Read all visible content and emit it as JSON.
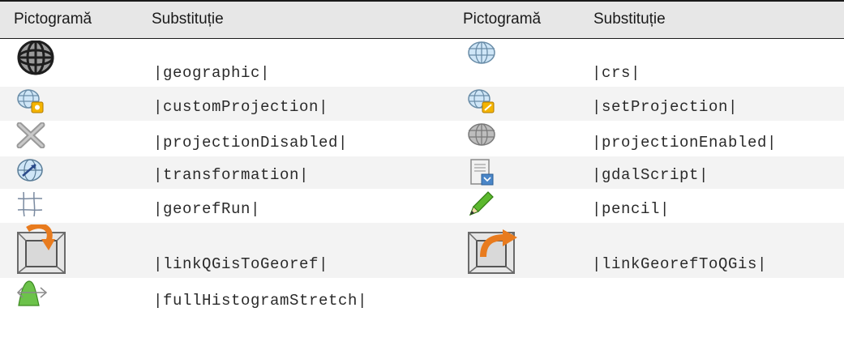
{
  "header": {
    "pictogram_label_1": "Pictogramă",
    "substitution_label_1": "Substituție",
    "pictogram_label_2": "Pictogramă",
    "substitution_label_2": "Substituție"
  },
  "rows": [
    {
      "left": {
        "icon": "geographic-globe-icon",
        "code": "|geographic|"
      },
      "right": {
        "icon": "crs-globe-icon",
        "code": "|crs|"
      }
    },
    {
      "left": {
        "icon": "custom-projection-icon",
        "code": "|customProjection|"
      },
      "right": {
        "icon": "set-projection-icon",
        "code": "|setProjection|"
      }
    },
    {
      "left": {
        "icon": "projection-disabled-icon",
        "code": "|projectionDisabled|"
      },
      "right": {
        "icon": "projection-enabled-icon",
        "code": "|projectionEnabled|"
      }
    },
    {
      "left": {
        "icon": "transformation-icon",
        "code": "|transformation|"
      },
      "right": {
        "icon": "gdal-script-icon",
        "code": "|gdalScript|"
      }
    },
    {
      "left": {
        "icon": "georef-run-icon",
        "code": "|georefRun|"
      },
      "right": {
        "icon": "pencil-icon",
        "code": "|pencil|"
      }
    },
    {
      "left": {
        "icon": "link-qgis-to-georef-icon",
        "code": "|linkQGisToGeoref|"
      },
      "right": {
        "icon": "link-georef-to-qgis-icon",
        "code": "|linkGeorefToQGis|"
      }
    },
    {
      "left": {
        "icon": "full-histogram-stretch-icon",
        "code": "|fullHistogramStretch|"
      },
      "right": {
        "icon": "",
        "code": ""
      }
    }
  ],
  "colors": {
    "header_bg": "#e7e7e7",
    "alt_row_bg": "#f3f3f3",
    "rule": "#1a1a1a"
  }
}
